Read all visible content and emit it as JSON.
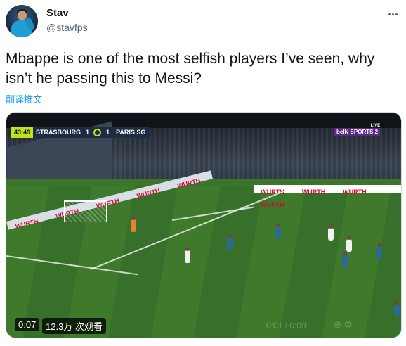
{
  "author": {
    "name": "Stav",
    "handle": "@stavfps"
  },
  "tweet": {
    "text": "Mbappe is one of the most selfish players I’ve seen, why isn’t he passing this to Messi?",
    "translate_label": "翻译推文"
  },
  "media": {
    "scorebug": {
      "clock": "43:49",
      "home_team": "STRASBOURG",
      "home_score": "1",
      "away_score": "1",
      "away_team": "PARIS SG"
    },
    "broadcaster": {
      "live_label": "LIVE",
      "logo_text": "beIN SPORTS 2"
    },
    "adboard_text": "WURTH",
    "video_time": "0:07",
    "view_count": "12.3万 次观看",
    "ghost_time": "0:01 / 0:09",
    "ghost_icons": "⊘  ⚙"
  },
  "icons": {
    "more": "more-dots-icon"
  }
}
